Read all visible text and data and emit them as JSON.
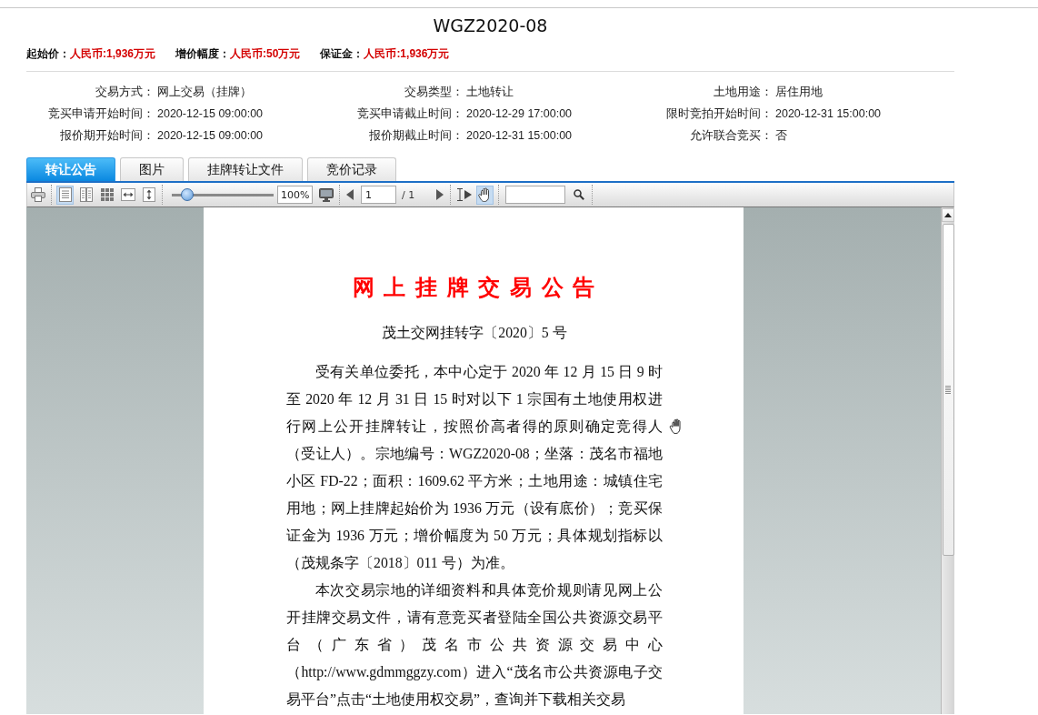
{
  "header": {
    "title": "WGZ2020-08"
  },
  "prices": [
    {
      "label": "起始价：",
      "value": "人民币:1,936万元"
    },
    {
      "label": "增价幅度：",
      "value": "人民币:50万元"
    },
    {
      "label": "保证金：",
      "value": "人民币:1,936万元"
    }
  ],
  "details": [
    {
      "label": "交易方式：",
      "value": "网上交易（挂牌）"
    },
    {
      "label": "交易类型：",
      "value": "土地转让"
    },
    {
      "label": "土地用途：",
      "value": "居住用地"
    },
    {
      "label": "竞买申请开始时间：",
      "value": "2020-12-15 09:00:00"
    },
    {
      "label": "竞买申请截止时间：",
      "value": "2020-12-29 17:00:00"
    },
    {
      "label": "限时竞拍开始时间：",
      "value": "2020-12-31 15:00:00"
    },
    {
      "label": "报价期开始时间：",
      "value": "2020-12-15 09:00:00"
    },
    {
      "label": "报价期截止时间：",
      "value": "2020-12-31 15:00:00"
    },
    {
      "label": "允许联合竞买：",
      "value": "否"
    }
  ],
  "tabs": [
    {
      "label": "转让公告",
      "selected": true
    },
    {
      "label": "图片",
      "selected": false
    },
    {
      "label": "挂牌转让文件",
      "selected": false
    },
    {
      "label": "竞价记录",
      "selected": false
    }
  ],
  "viewer": {
    "toolbar": {
      "view_modes": [
        {
          "kind": "single-page",
          "selected": true
        },
        {
          "kind": "two-page",
          "selected": false
        },
        {
          "kind": "thumbnails",
          "selected": false
        }
      ],
      "zoom": {
        "level": 0.15,
        "value": "100%"
      },
      "page": {
        "value": "1",
        "total": "/ 1"
      },
      "tools": [
        {
          "kind": "text-select",
          "selected": false
        },
        {
          "kind": "hand",
          "selected": true
        }
      ]
    },
    "document": {
      "title": "网 上 挂 牌 交 易 公 告",
      "reference": "茂土交网挂转字〔2020〕5 号",
      "paragraphs": [
        "受有关单位委托，本中心定于 2020 年 12 月 15 日 9 时至 2020 年 12 月 31 日 15 时对以下 1 宗国有土地使用权进行网上公开挂牌转让，按照价高者得的原则确定竞得人（受让人）。宗地编号：WGZ2020-08；坐落：茂名市福地小区 FD-22；面积：1609.62 平方米；土地用途：城镇住宅用地；网上挂牌起始价为 1936 万元（设有底价）；竞买保证金为 1936 万元；增价幅度为 50 万元；具体规划指标以（茂规条字〔2018〕011 号）为准。",
        "本次交易宗地的详细资料和具体竞价规则请见网上公开挂牌交易文件，请有意竞买者登陆全国公共资源交易平台（广东省）茂名市公共资源交易中心（http://www.gdmmggzy.com）进入“茂名市公共资源电子交易平台”点击“土地使用权交易”，查询并下载相关交易"
      ]
    }
  }
}
